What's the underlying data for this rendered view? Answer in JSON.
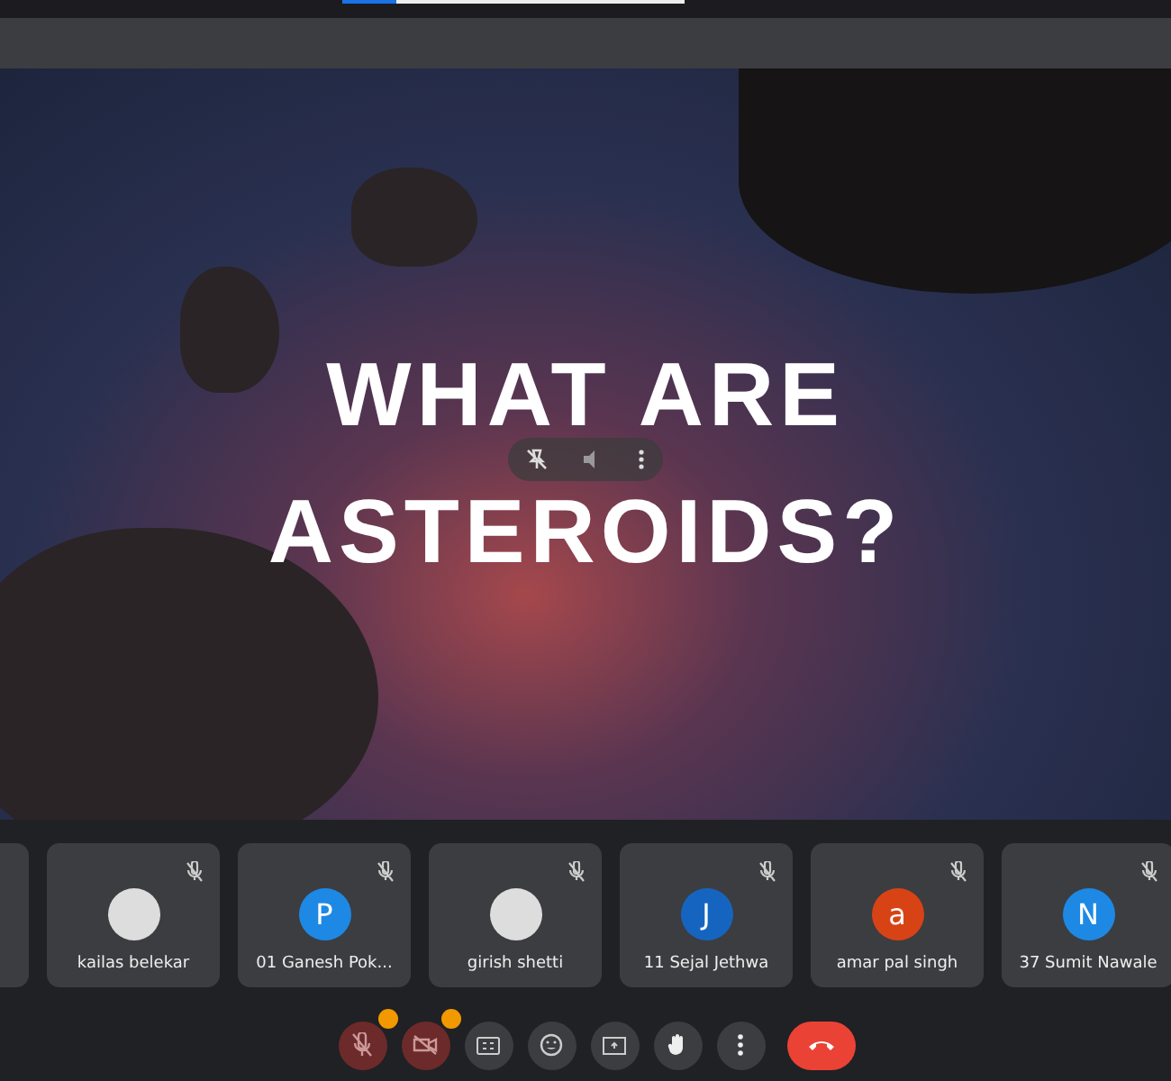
{
  "slide": {
    "title_lines": [
      "WHAT ARE",
      "ASTEROIDS?"
    ]
  },
  "participants": [
    {
      "name": "kailas belekar",
      "avatar": {
        "kind": "photo"
      },
      "muted": true
    },
    {
      "name": "01 Ganesh Pok...",
      "avatar": {
        "kind": "letter",
        "letter": "P",
        "color": "#1e88e5"
      },
      "muted": true
    },
    {
      "name": "girish shetti",
      "avatar": {
        "kind": "photo"
      },
      "muted": true
    },
    {
      "name": "11 Sejal Jethwa",
      "avatar": {
        "kind": "letter",
        "letter": "J",
        "color": "#1565c0"
      },
      "muted": true
    },
    {
      "name": "amar pal singh",
      "avatar": {
        "kind": "letter",
        "letter": "a",
        "color": "#d84315"
      },
      "muted": true
    },
    {
      "name": "37 Sumit Nawale",
      "avatar": {
        "kind": "letter",
        "letter": "N",
        "color": "#1e88e5"
      },
      "muted": true
    }
  ],
  "controls": [
    {
      "kind": "mic",
      "off": true,
      "warning": true
    },
    {
      "kind": "camera",
      "off": true,
      "warning": true
    },
    {
      "kind": "captions",
      "warning": false
    },
    {
      "kind": "emoji",
      "warning": false
    },
    {
      "kind": "present",
      "warning": false
    },
    {
      "kind": "hand",
      "warning": false
    },
    {
      "kind": "more",
      "warning": false
    },
    {
      "kind": "leave",
      "warning": false
    }
  ]
}
